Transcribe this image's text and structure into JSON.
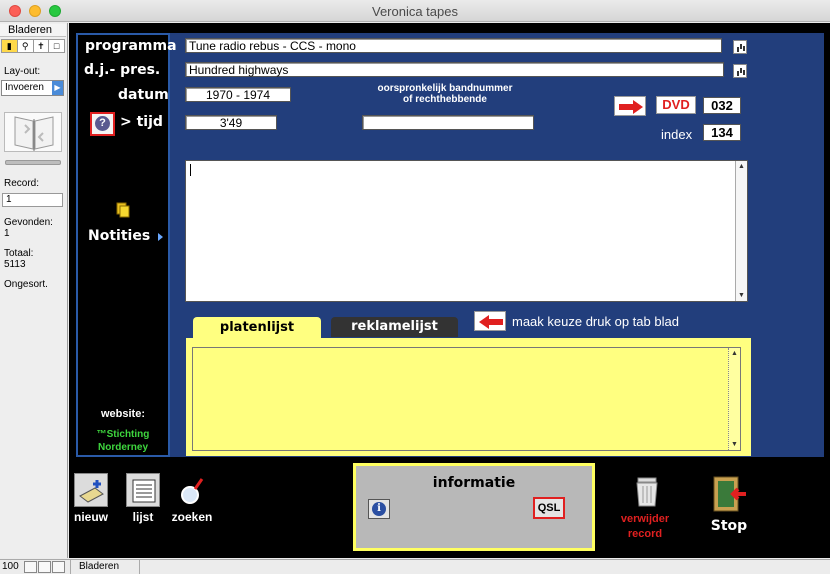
{
  "window": {
    "title": "Veronica tapes"
  },
  "status_panel": {
    "mode": "Bladeren",
    "layout_label": "Lay-out:",
    "layout_value": "Invoeren",
    "record_label": "Record:",
    "record_value": "1",
    "found_label": "Gevonden:",
    "found_value": "1",
    "total_label": "Totaal:",
    "total_value": "5113",
    "unsorted_label": "Ongesort."
  },
  "form": {
    "programma_label": "programma",
    "programma_value": "Tune radio rebus - CCS - mono",
    "dj_label": "d.j.- pres.",
    "dj_value": "Hundred highways",
    "datum_label": "datum",
    "datum_value": "1970 - 1974",
    "tijd_label": "> tijd",
    "tijd_value": "3'49",
    "bandnummer_label_1": "oorspronkelijk bandnummer",
    "bandnummer_label_2": "of rechthebbende",
    "bandnummer_value": "",
    "media_type": "DVD",
    "media_number": "032",
    "index_label": "index",
    "index_value": "134",
    "notes_value": "",
    "notities_label": "Notities",
    "website_label": "website:",
    "website_line1": "™Stichting",
    "website_line2": "Norderney"
  },
  "tabs": {
    "platenlijst": "platenlijst",
    "reklamelijst": "reklamelijst",
    "hint": "maak keuze druk op tab blad",
    "list_value": ""
  },
  "toolbar": {
    "new_label": "nieuw",
    "list_label": "lijst",
    "search_label": "zoeken",
    "info_title": "informatie",
    "info_icon_glyph": "i",
    "qsl_label": "QSL",
    "delete_line1": "verwijder",
    "delete_line2": "record",
    "stop_label": "Stop"
  },
  "footer": {
    "zoom": "100",
    "mode": "Bladeren"
  },
  "colors": {
    "accent_red": "#e02020",
    "panel_blue": "#223e7c",
    "tab_yellow": "#ffff80",
    "website_green": "#3ed63e"
  }
}
